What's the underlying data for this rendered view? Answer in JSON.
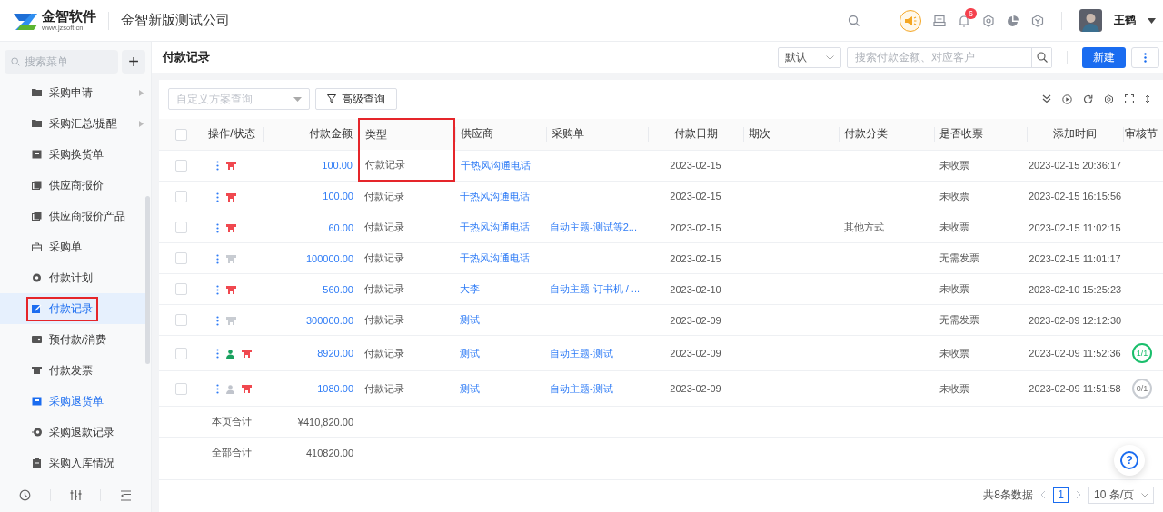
{
  "header": {
    "logo_name": "金智软件",
    "logo_url": "www.jzsoft.cn",
    "company": "金智新版测试公司",
    "notification_count": "6",
    "user_name": "王鹤"
  },
  "sidebar": {
    "search_placeholder": "搜索菜单",
    "add_label": "+",
    "items": [
      {
        "label": "采购申请",
        "has_submenu": true,
        "selected": false,
        "hovered": false,
        "highlighted": false
      },
      {
        "label": "采购汇总/提醒",
        "has_submenu": true,
        "selected": false,
        "hovered": false,
        "highlighted": false
      },
      {
        "label": "采购换货单",
        "has_submenu": false,
        "selected": false,
        "hovered": false,
        "highlighted": false
      },
      {
        "label": "供应商报价",
        "has_submenu": false,
        "selected": false,
        "hovered": false,
        "highlighted": false
      },
      {
        "label": "供应商报价产品",
        "has_submenu": false,
        "selected": false,
        "hovered": false,
        "highlighted": false
      },
      {
        "label": "采购单",
        "has_submenu": false,
        "selected": false,
        "hovered": false,
        "highlighted": false
      },
      {
        "label": "付款计划",
        "has_submenu": false,
        "selected": false,
        "hovered": false,
        "highlighted": false
      },
      {
        "label": "付款记录",
        "has_submenu": false,
        "selected": true,
        "hovered": false,
        "highlighted": true
      },
      {
        "label": "预付款/消费",
        "has_submenu": false,
        "selected": false,
        "hovered": false,
        "highlighted": false
      },
      {
        "label": "付款发票",
        "has_submenu": false,
        "selected": false,
        "hovered": false,
        "highlighted": false
      },
      {
        "label": "采购退货单",
        "has_submenu": false,
        "selected": false,
        "hovered": true,
        "highlighted": false
      },
      {
        "label": "采购退款记录",
        "has_submenu": false,
        "selected": false,
        "hovered": false,
        "highlighted": false
      },
      {
        "label": "采购入库情况",
        "has_submenu": false,
        "selected": false,
        "hovered": false,
        "highlighted": false
      }
    ]
  },
  "toolbar": {
    "title": "付款记录",
    "view_select": "默认",
    "search_placeholder": "搜索付款金额、对应客户",
    "new_button": "新建"
  },
  "filters": {
    "scheme_placeholder": "自定义方案查询",
    "advanced_button": "高级查询"
  },
  "table": {
    "all_checked": false,
    "columns": [
      {
        "label": "操作/状态",
        "highlighted": false
      },
      {
        "label": "付款金额",
        "highlighted": false
      },
      {
        "label": "类型",
        "highlighted": true
      },
      {
        "label": "供应商",
        "highlighted": false
      },
      {
        "label": "采购单",
        "highlighted": false
      },
      {
        "label": "付款日期",
        "highlighted": false
      },
      {
        "label": "期次",
        "highlighted": false
      },
      {
        "label": "付款分类",
        "highlighted": false
      },
      {
        "label": "是否收票",
        "highlighted": false
      },
      {
        "label": "添加时间",
        "highlighted": false
      },
      {
        "label": "审核节",
        "highlighted": false
      }
    ],
    "rows": [
      {
        "checked": false,
        "invoice_on": true,
        "amount": "100.00",
        "type": "付款记录",
        "supplier": "干热风沟通电话",
        "date": "2023-02-15",
        "invoice_status": "未收票",
        "added": "2023-02-15 20:36:17"
      },
      {
        "checked": false,
        "invoice_on": true,
        "amount": "100.00",
        "type": "付款记录",
        "supplier": "干热风沟通电话",
        "date": "2023-02-15",
        "invoice_status": "未收票",
        "added": "2023-02-15 16:15:56"
      },
      {
        "checked": false,
        "invoice_on": true,
        "amount": "60.00",
        "type": "付款记录",
        "supplier": "干热风沟通电话",
        "order": "自动主题-测试等2...",
        "date": "2023-02-15",
        "category": "其他方式",
        "invoice_status": "未收票",
        "added": "2023-02-15 11:02:15"
      },
      {
        "checked": false,
        "invoice_on": false,
        "amount": "100000.00",
        "type": "付款记录",
        "supplier": "干热风沟通电话",
        "date": "2023-02-15",
        "invoice_status": "无需发票",
        "added": "2023-02-15 11:01:17"
      },
      {
        "checked": false,
        "invoice_on": true,
        "amount": "560.00",
        "type": "付款记录",
        "supplier": "大李",
        "order": "自动主题-订书机 / ...",
        "date": "2023-02-10",
        "invoice_status": "未收票",
        "added": "2023-02-10 15:25:23"
      },
      {
        "checked": false,
        "invoice_on": false,
        "amount": "300000.00",
        "type": "付款记录",
        "supplier": "测试",
        "date": "2023-02-09",
        "invoice_status": "无需发票",
        "added": "2023-02-09 12:12:30"
      },
      {
        "checked": false,
        "approved": true,
        "invoice_on": true,
        "amount": "8920.00",
        "type": "付款记录",
        "supplier": "测试",
        "order": "自动主题-测试",
        "date": "2023-02-09",
        "invoice_status": "未收票",
        "added": "2023-02-09 11:52:36",
        "audit": {
          "text": "1/1",
          "done": true
        }
      },
      {
        "checked": false,
        "approved": false,
        "invoice_on": true,
        "amount": "1080.00",
        "type": "付款记录",
        "supplier": "测试",
        "order": "自动主题-测试",
        "date": "2023-02-09",
        "invoice_status": "未收票",
        "added": "2023-02-09 11:51:58",
        "audit": {
          "text": "0/1",
          "done": false
        }
      }
    ],
    "summary": [
      {
        "label": "本页合计",
        "amount": "¥410,820.00"
      },
      {
        "label": "全部合计",
        "amount": "410820.00"
      }
    ]
  },
  "pager": {
    "total": "共8条数据",
    "pages": [
      {
        "label": "1",
        "selected": true
      }
    ],
    "page_size": "10 条/页"
  },
  "help_label": "?"
}
